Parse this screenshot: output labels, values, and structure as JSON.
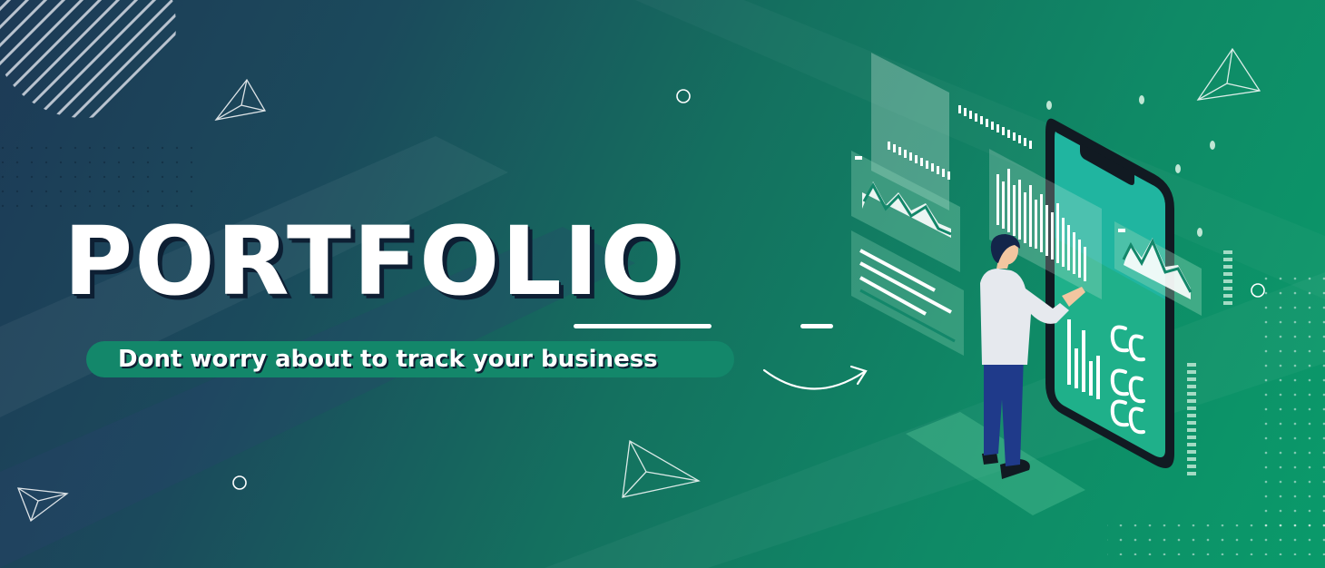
{
  "banner": {
    "title": "PORTFOLIO",
    "subtitle": "Dont worry about to track your business"
  },
  "colors": {
    "background_dark": "#1d3a56",
    "background_green": "#0a9a6a",
    "accent_green": "#13876a",
    "title_shadow": "#0d1f33",
    "phone_body": "#111a22",
    "screen": "#1fb08a"
  },
  "icons": [
    "triangle-icon",
    "circle-icon",
    "arrow-icon"
  ]
}
